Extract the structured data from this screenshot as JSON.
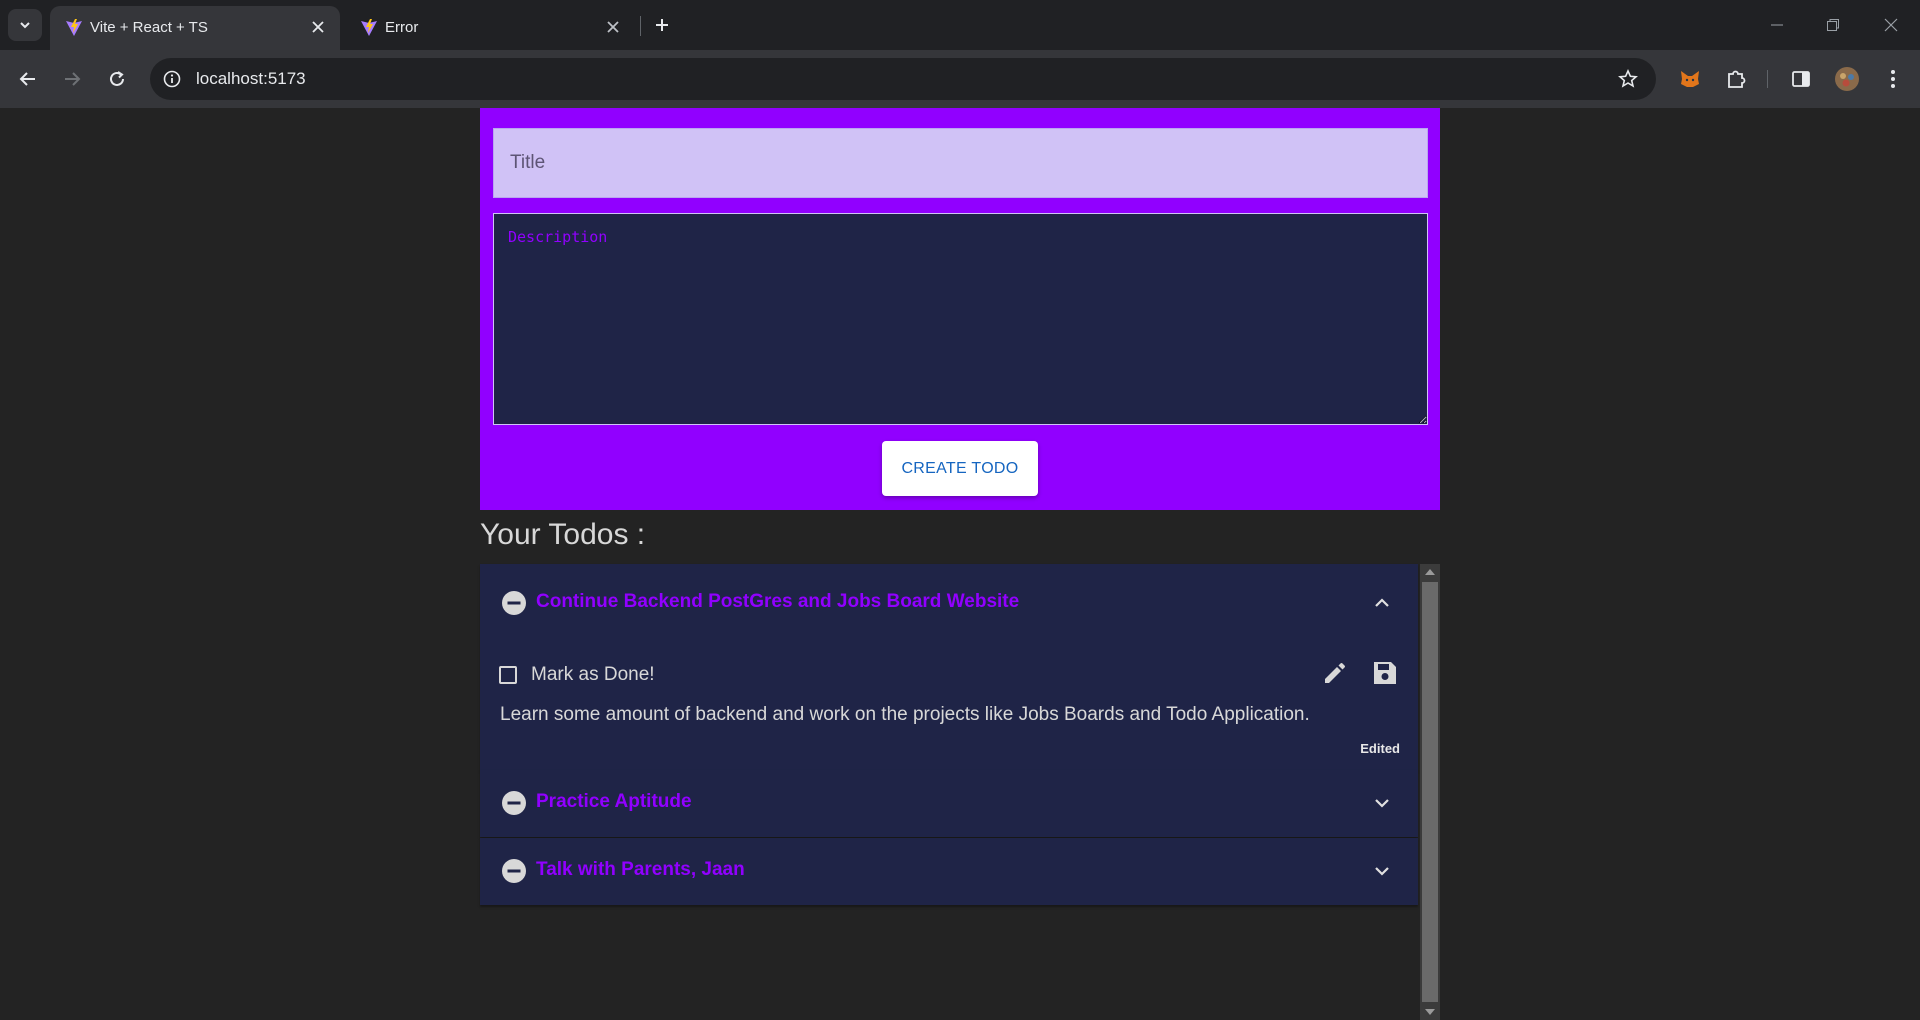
{
  "browser": {
    "tabs": [
      {
        "title": "Vite + React + TS",
        "active": true,
        "icon": "vite-icon"
      },
      {
        "title": "Error",
        "active": false,
        "icon": "vite-icon"
      }
    ],
    "url": "localhost:5173"
  },
  "form": {
    "title_placeholder": "Title",
    "title_value": "",
    "description_placeholder": "Description",
    "description_value": "",
    "create_label": "CREATE TODO"
  },
  "todos_heading": "Your Todos :",
  "todos": [
    {
      "title": "Continue Backend PostGres and Jobs Board Website",
      "expanded": true,
      "done_label": "Mark as Done!",
      "done": false,
      "description": "Learn some amount of backend and work on the projects like Jobs Boards and Todo Application.",
      "status": "Edited"
    },
    {
      "title": "Practice Aptitude",
      "expanded": false
    },
    {
      "title": "Talk with Parents, Jaan",
      "expanded": false
    }
  ],
  "colors": {
    "accent": "#9100ff",
    "card_bg": "#1f2447",
    "title_input_bg": "#d0c2f6",
    "button_text": "#1565c0",
    "page_bg": "#232323"
  }
}
